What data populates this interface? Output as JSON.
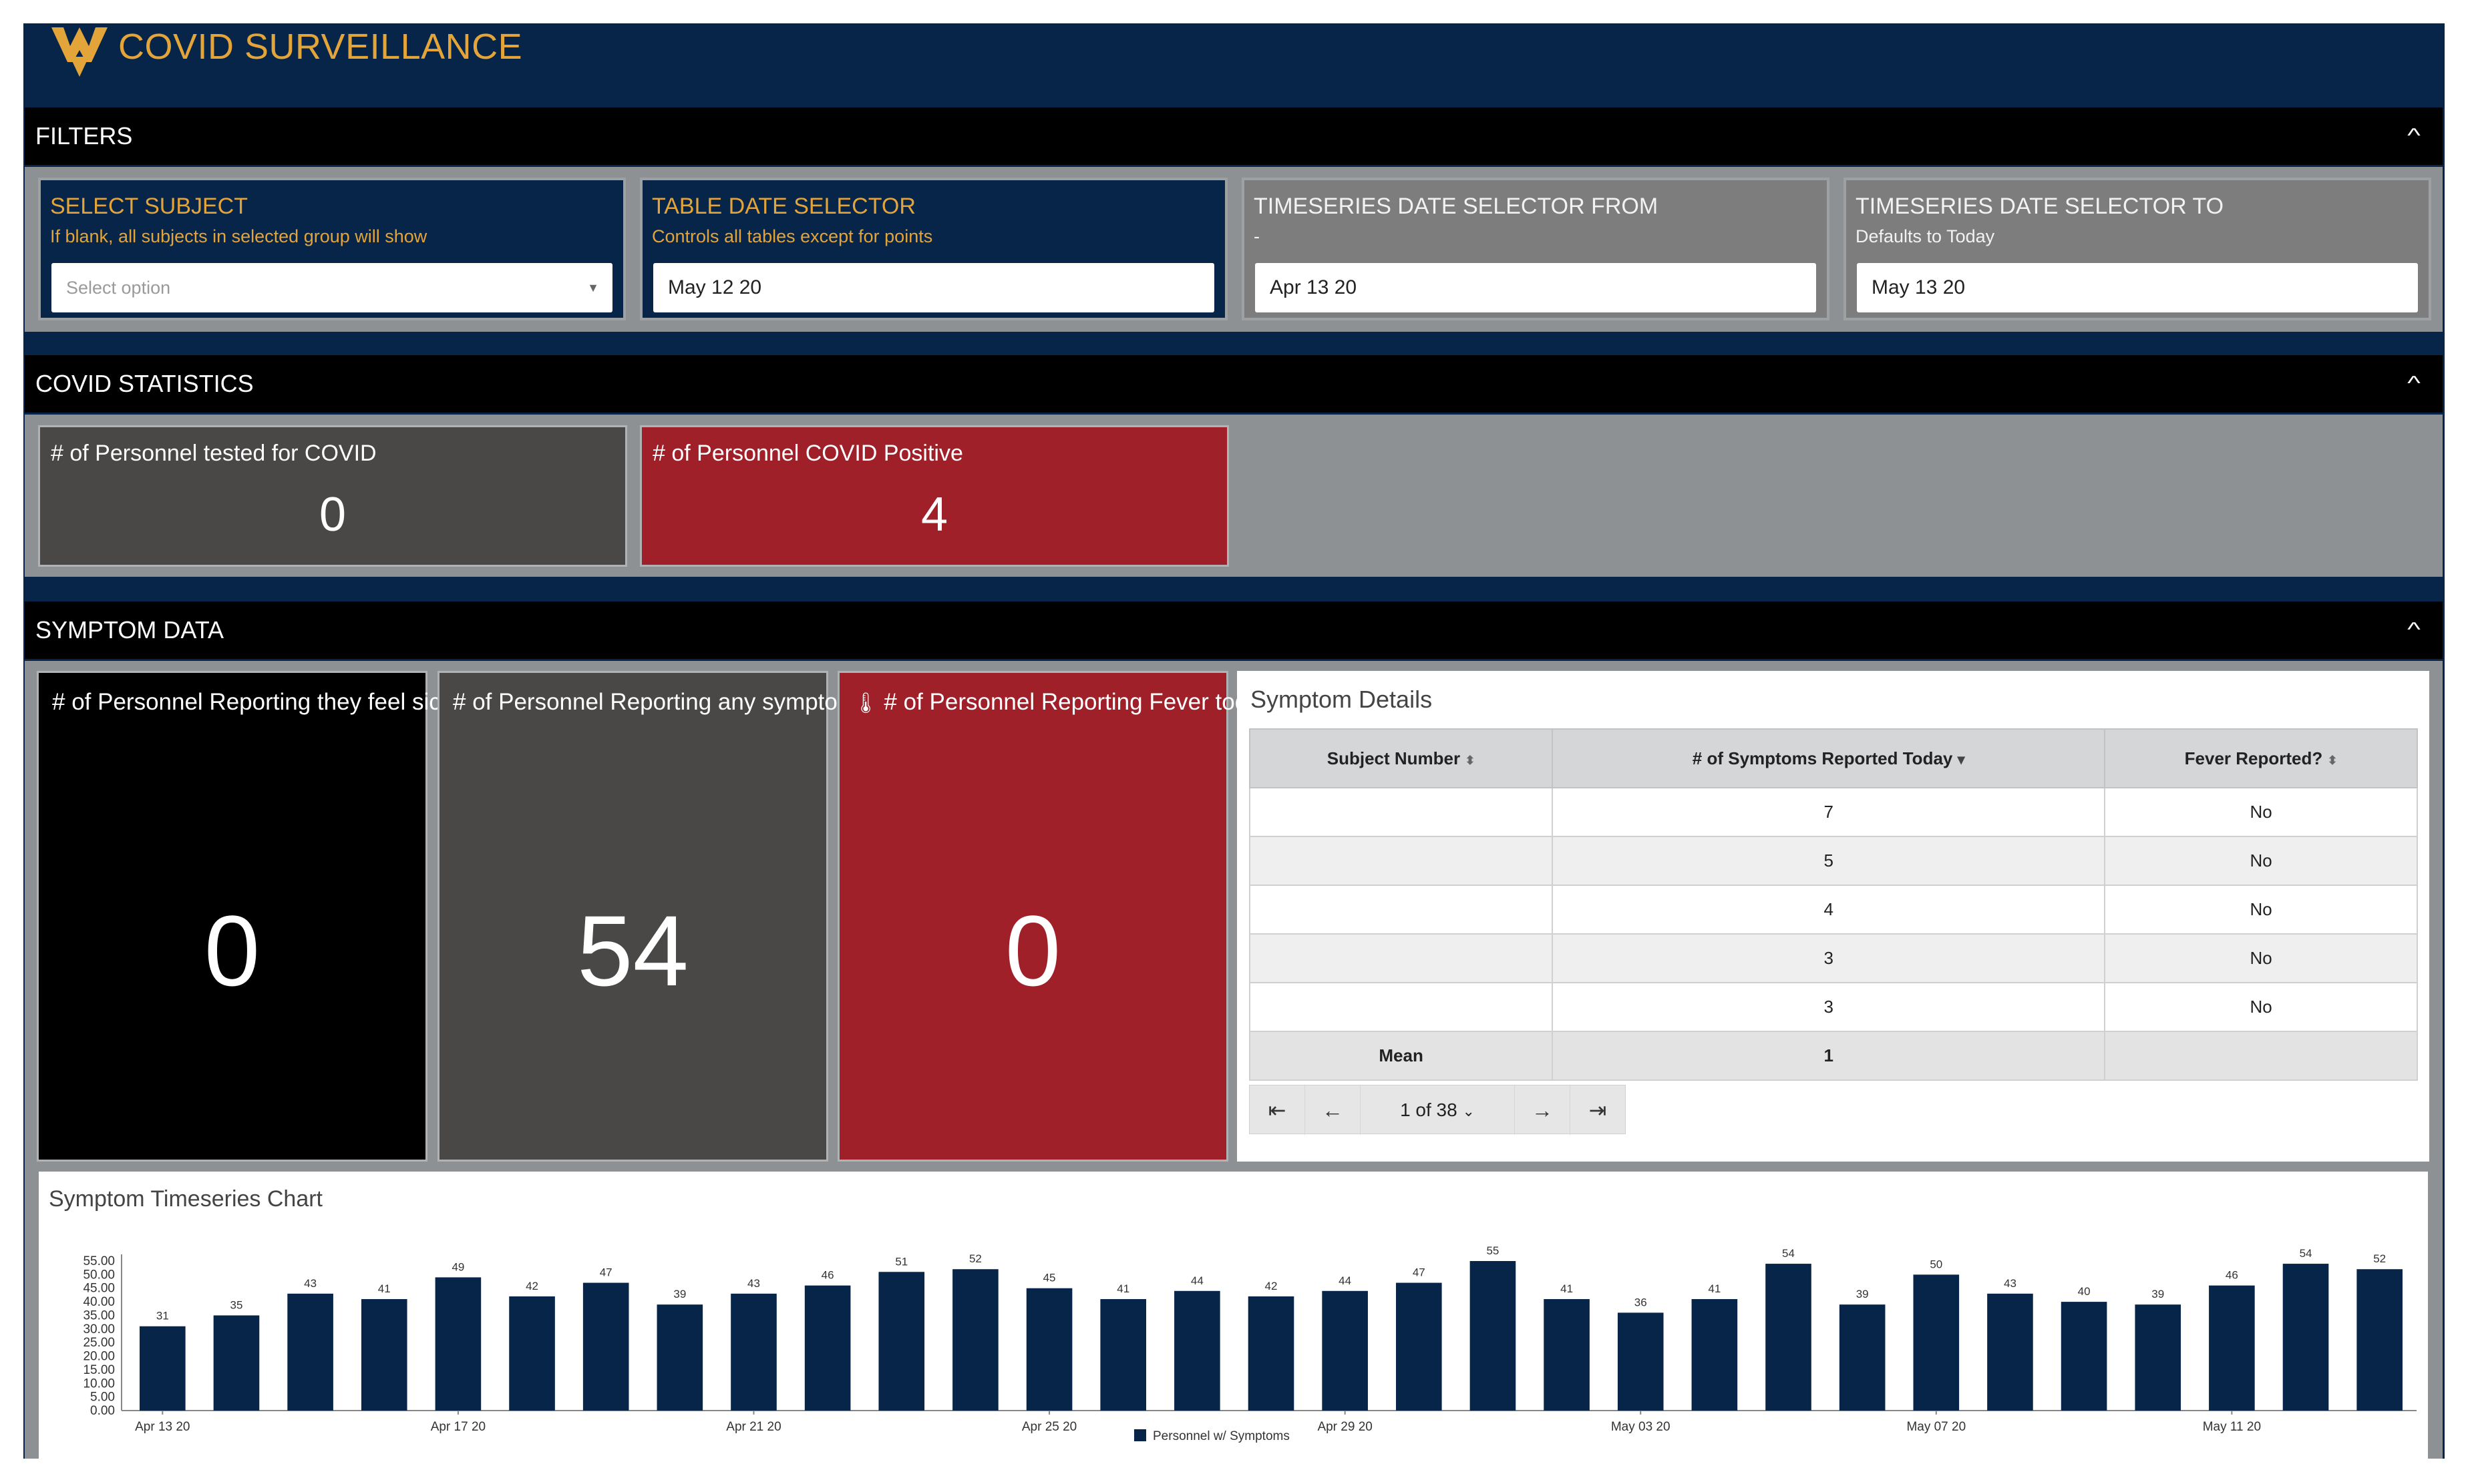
{
  "app": {
    "title": "COVID SURVEILLANCE",
    "logo_icon": "wv-logo-icon"
  },
  "colors": {
    "navy": "#072548",
    "gold": "#e3a43a",
    "red": "#a0202a",
    "dark": "#4a4747",
    "black": "#000000"
  },
  "filters": {
    "title": "FILTERS",
    "subject": {
      "label": "SELECT SUBJECT",
      "sub": "If blank, all subjects in selected group will show",
      "placeholder": "Select option"
    },
    "table_date": {
      "label": "TABLE DATE SELECTOR",
      "sub": "Controls all tables except for points",
      "value": "May 12 20"
    },
    "ts_from": {
      "label": "TIMESERIES DATE SELECTOR FROM",
      "sub": "-",
      "value": "Apr 13 20"
    },
    "ts_to": {
      "label": "TIMESERIES DATE SELECTOR TO",
      "sub": "Defaults to Today",
      "value": "May 13 20"
    }
  },
  "covid_stats": {
    "title": "COVID STATISTICS",
    "tested": {
      "label": "# of Personnel tested for COVID",
      "value": "0"
    },
    "positive": {
      "label": "# of Personnel COVID Positive",
      "value": "4"
    }
  },
  "symptom_data": {
    "title": "SYMPTOM DATA",
    "sick": {
      "label": "# of Personnel Reporting they feel sick today",
      "value": "0"
    },
    "any": {
      "label": "# of Personnel Reporting any symptoms today",
      "value": "54"
    },
    "fever": {
      "label": "# of Personnel Reporting Fever today",
      "value": "0",
      "icon": "thermometer-icon"
    }
  },
  "details": {
    "title": "Symptom Details",
    "columns": [
      "Subject Number",
      "# of Symptoms Reported Today",
      "Fever Reported?"
    ],
    "sort_icons": [
      "⬍",
      "▾",
      "⬍"
    ],
    "rows": [
      {
        "subject": "",
        "symptoms": "7",
        "fever": "No"
      },
      {
        "subject": "",
        "symptoms": "5",
        "fever": "No"
      },
      {
        "subject": "",
        "symptoms": "4",
        "fever": "No"
      },
      {
        "subject": "",
        "symptoms": "3",
        "fever": "No"
      },
      {
        "subject": "",
        "symptoms": "3",
        "fever": "No"
      }
    ],
    "mean": {
      "label": "Mean",
      "symptoms": "1",
      "fever": ""
    },
    "pagination": {
      "page": "1 of 38"
    }
  },
  "chart_data": {
    "type": "bar",
    "title": "Symptom Timeseries Chart",
    "categories": [
      "Apr 13 20",
      "Apr 14 20",
      "Apr 15 20",
      "Apr 16 20",
      "Apr 17 20",
      "Apr 18 20",
      "Apr 19 20",
      "Apr 20 20",
      "Apr 21 20",
      "Apr 22 20",
      "Apr 23 20",
      "Apr 24 20",
      "Apr 25 20",
      "Apr 26 20",
      "Apr 27 20",
      "Apr 28 20",
      "Apr 29 20",
      "Apr 30 20",
      "May 01 20",
      "May 02 20",
      "May 03 20",
      "May 04 20",
      "May 05 20",
      "May 06 20",
      "May 07 20",
      "May 08 20",
      "May 09 20",
      "May 10 20",
      "May 11 20",
      "May 12 20",
      "May 13 20"
    ],
    "series": [
      {
        "name": "Personnel w/ Symptoms",
        "color": "#072548",
        "values": [
          31,
          35,
          43,
          41,
          49,
          42,
          47,
          39,
          43,
          46,
          51,
          52,
          45,
          41,
          44,
          42,
          44,
          47,
          55,
          41,
          36,
          41,
          54,
          39,
          50,
          43,
          40,
          39,
          46,
          54,
          52
        ]
      }
    ],
    "x_tick_labels": [
      "Apr 13 20",
      "Apr 17 20",
      "Apr 21 20",
      "Apr 25 20",
      "Apr 29 20",
      "May 03 20",
      "May 07 20",
      "May 11 20"
    ],
    "y_tick_labels": [
      "55.00",
      "50.00",
      "45.00",
      "40.00",
      "35.00",
      "30.00",
      "25.00",
      "20.00",
      "15.00",
      "10.00",
      "5.00",
      "0.00"
    ],
    "ylim": [
      0,
      55
    ],
    "legend": "bottom-center",
    "grid": false
  }
}
